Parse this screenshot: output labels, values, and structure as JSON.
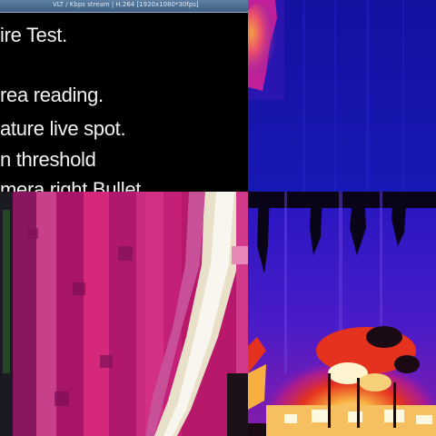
{
  "video_window": {
    "title_bar": "VLT / Kbps stream | H.264 [1920x1080*30fps]"
  },
  "text_panel": {
    "lines": [
      "ire Test.",
      "rea reading.",
      "ature live spot.",
      "n threshold",
      "mera right Bullet"
    ]
  },
  "colors": {
    "thermal_blue": "#1a1ab8",
    "thermal_purple": "#5a1fd0",
    "hot_magenta": "#e0208a",
    "hot_orange": "#f07a20",
    "hot_white": "#fff4d0"
  },
  "icons": {
    "fire": "flame-hotspot"
  }
}
